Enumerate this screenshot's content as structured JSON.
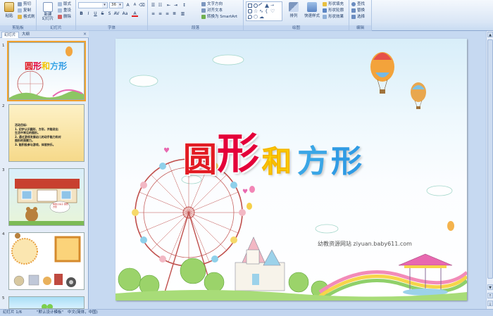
{
  "ribbon": {
    "clipboard": {
      "paste": "粘贴",
      "cut": "剪切",
      "copy": "复制",
      "painter": "格式刷",
      "label": "剪贴板"
    },
    "slides": {
      "new_slide": "新建\n幻灯片",
      "layout": "版式",
      "reset": "重设",
      "delete": "删除",
      "label": "幻灯片"
    },
    "font": {
      "font_size": "36",
      "label": "字体"
    },
    "paragraph": {
      "text_direction": "文字方向",
      "align_text": "对齐文本",
      "smartart": "转换为 SmartArt",
      "label": "段落"
    },
    "drawing": {
      "arrange": "排列",
      "quick_styles": "快速样式",
      "shape_fill": "形状填充",
      "shape_outline": "形状轮廓",
      "shape_effects": "形状效果",
      "label": "绘图"
    },
    "editing": {
      "find": "查找",
      "replace": "替换",
      "select": "选择",
      "label": "编辑"
    }
  },
  "pane": {
    "tabs": [
      "幻灯片",
      "大纲"
    ],
    "thumbnails": [
      {
        "num": "1",
        "title": "圆形和方形"
      },
      {
        "num": "2",
        "lines": [
          "活动目标:",
          "1. 初步认识圆形、方形，并能说出",
          "   生活中常见的图形。",
          "2. 通过游戏发展幼儿的动手能力和对",
          "   图形的观察力。",
          "3. 能积极参与游戏，体验快乐。"
        ]
      },
      {
        "num": "3",
        "bubble": "我的小房子 圆形 方形"
      },
      {
        "num": "4"
      },
      {
        "num": "5"
      }
    ]
  },
  "slide": {
    "title_chars": [
      "圆",
      "形",
      "和",
      "方",
      "形"
    ],
    "watermark": "幼教资源网站  ziyuan.baby611.com"
  },
  "status": {
    "slide_info": "幻灯片 1/6",
    "theme": "\"默认设计模板\"",
    "language": "中文(简体，中国)"
  },
  "colors": {
    "ribbon_bg": "#dbe7f6",
    "accent": "#15428b",
    "title_red": "#e21b23",
    "title_yellow": "#ffe400",
    "title_blue": "#3aa6e6"
  }
}
